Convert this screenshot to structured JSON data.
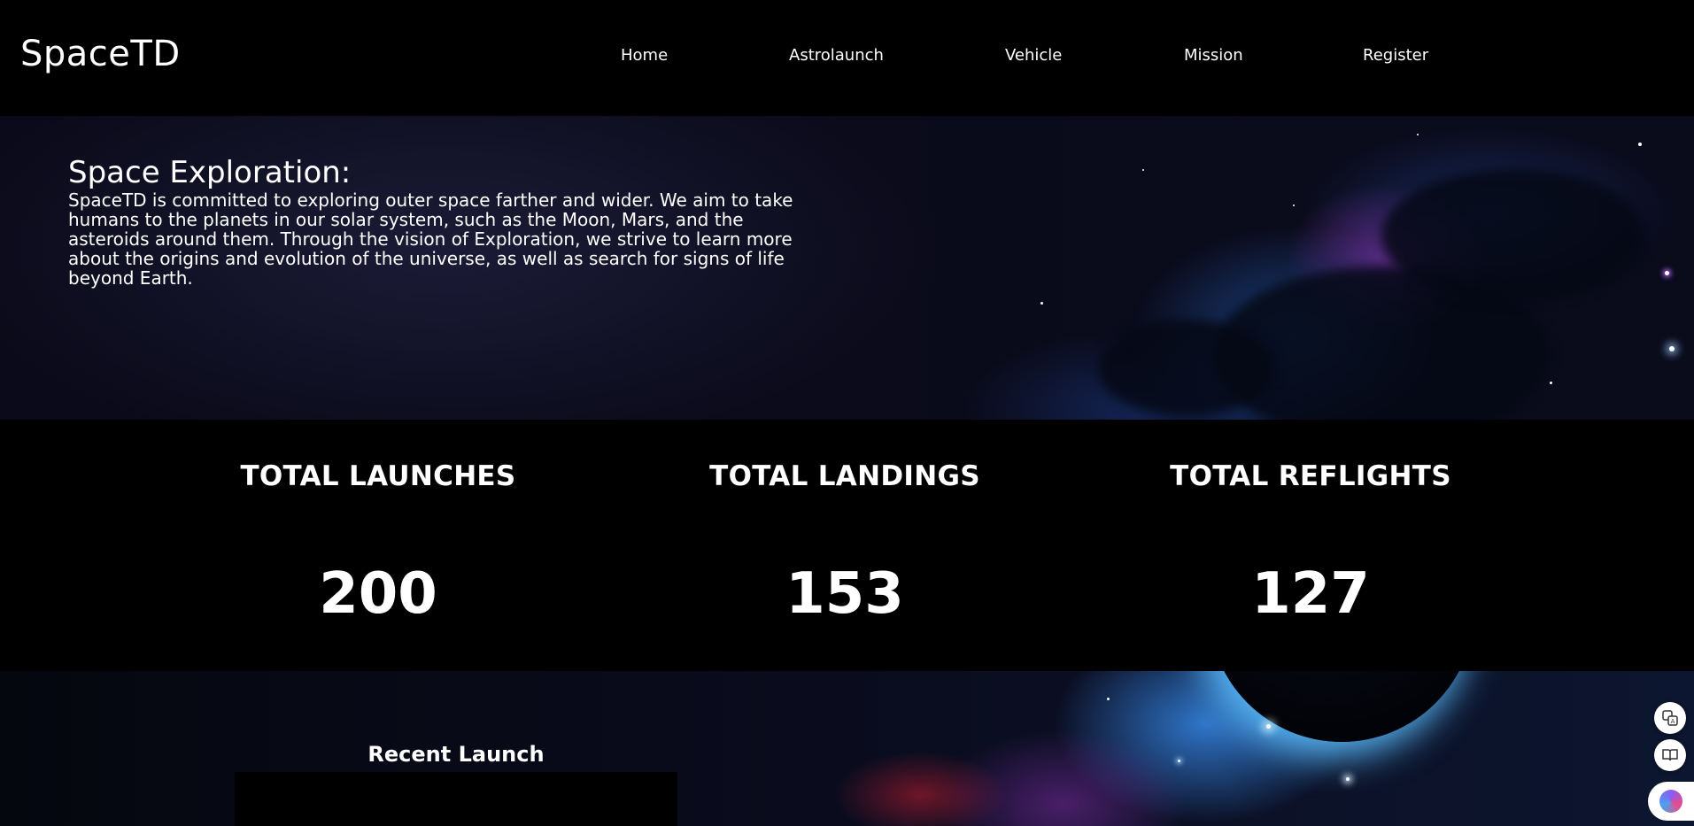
{
  "header": {
    "logo": "SpaceTD",
    "nav": [
      {
        "label": "Home"
      },
      {
        "label": "Astrolaunch"
      },
      {
        "label": "Vehicle"
      },
      {
        "label": "Mission"
      },
      {
        "label": "Register"
      }
    ]
  },
  "hero": {
    "title": "Space Exploration:",
    "text": "SpaceTD is committed to exploring outer space farther and wider. We aim to take humans to the planets in our solar system, such as the Moon, Mars, and the asteroids around them. Through the vision of Exploration, we strive to learn more about the origins and evolution of the universe, as well as search for signs of life beyond Earth."
  },
  "stats": [
    {
      "label": "TOTAL LAUNCHES",
      "value": "200"
    },
    {
      "label": "TOTAL LANDINGS",
      "value": "153"
    },
    {
      "label": "TOTAL REFLIGHTS",
      "value": "127"
    }
  ],
  "recent": {
    "title": "Recent Launch"
  },
  "floating_tools": [
    {
      "icon": "translate-icon"
    },
    {
      "icon": "reader-icon"
    },
    {
      "icon": "brain-icon"
    }
  ]
}
